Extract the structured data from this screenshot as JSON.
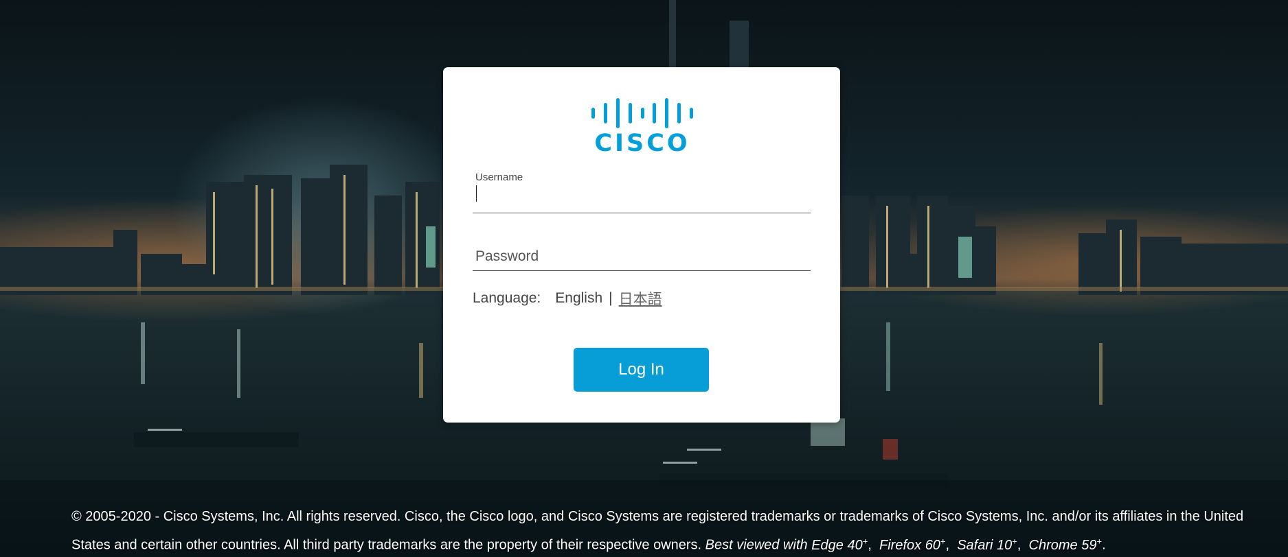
{
  "background": {
    "description_icon": "city-skyline-night-background"
  },
  "logo": {
    "wordmark": "CISCO",
    "color": "#049fd9"
  },
  "form": {
    "username_label": "Username",
    "username_value": "",
    "password_placeholder": "Password",
    "password_value": "",
    "language_label": "Language:",
    "language_current": "English",
    "language_separator": "|",
    "language_alternate": "日本語",
    "login_button": "Log In",
    "button_color": "#079ed7"
  },
  "footer": {
    "copyright": "© 2005-2020 - Cisco Systems, Inc. All rights reserved. Cisco, the Cisco logo, and Cisco Systems are registered trademarks or trademarks of Cisco Systems, Inc. and/or its affiliates in the United States and certain other countries. All third party trademarks are the property of their respective owners.",
    "best_viewed": "Best viewed with",
    "browsers": [
      {
        "name": "Edge",
        "version": "40",
        "suffix": "+"
      },
      {
        "name": "Firefox",
        "version": "60",
        "suffix": "+"
      },
      {
        "name": "Safari",
        "version": "10",
        "suffix": "+"
      },
      {
        "name": "Chrome",
        "version": "59",
        "suffix": "+"
      }
    ]
  }
}
